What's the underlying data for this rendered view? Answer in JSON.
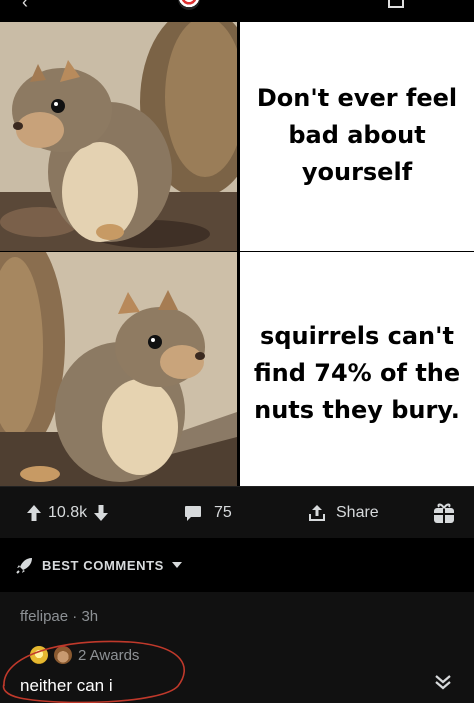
{
  "post": {
    "panels": [
      {
        "text": "Don't ever feel bad about yourself"
      },
      {
        "text": "squirrels can't find 74% of the nuts they bury."
      }
    ]
  },
  "actions": {
    "votes": "10.8k",
    "comments": "75",
    "share_label": "Share"
  },
  "sort": {
    "label": "BEST COMMENTS"
  },
  "comment": {
    "author": "ffelipae",
    "age": "3h",
    "separator": "·",
    "awards_label": "2 Awards",
    "body": "neither can i"
  },
  "icons": [
    "back-icon",
    "subreddit-avatar-icon",
    "bookmark-icon",
    "upvote-icon",
    "downvote-icon",
    "comment-icon",
    "share-icon",
    "gift-icon",
    "rocket-icon",
    "caret-down-icon",
    "award-icon",
    "expand-icon"
  ],
  "colors": {
    "background": "#000000",
    "bar": "#111111",
    "text": "#d7dadc",
    "muted": "#8d9195",
    "annotation": "#c0392b"
  }
}
